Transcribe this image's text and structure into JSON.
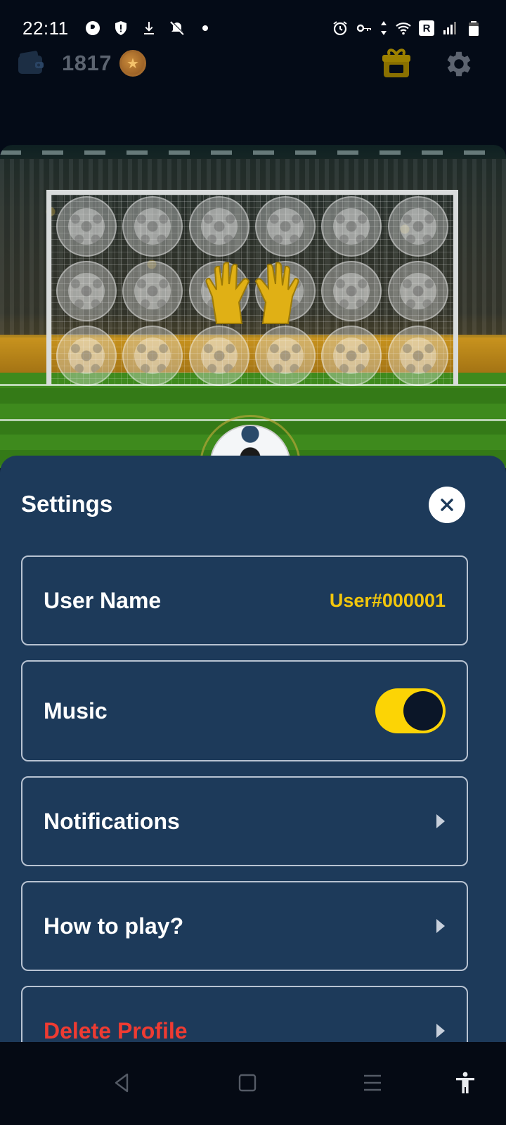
{
  "status_bar": {
    "time": "22:11",
    "left_icons": [
      "app-icon",
      "shield-icon",
      "download-icon",
      "mute-bell-icon",
      "dot-icon"
    ],
    "right_icons": [
      "alarm-icon",
      "vpn-key-icon",
      "data-arrows-icon",
      "wifi-icon",
      "roaming-badge-icon",
      "signal-icon",
      "battery-icon"
    ],
    "roaming_letter": "R"
  },
  "game_header": {
    "balance": "1817",
    "coin_symbol": "★"
  },
  "settings": {
    "title": "Settings",
    "user_name_label": "User Name",
    "user_name_value": "User#000001",
    "music_label": "Music",
    "music_on": true,
    "notifications_label": "Notifications",
    "how_to_play_label": "How to play?",
    "delete_profile_label": "Delete Profile"
  },
  "colors": {
    "sheet_bg": "#1d3a5a",
    "accent_yellow": "#f2c60c",
    "toggle_on": "#fcd405",
    "danger": "#ef3b32",
    "border": "#b8c3d2"
  },
  "nav_bar": {
    "icons": [
      "back-icon",
      "home-icon",
      "recents-icon",
      "accessibility-icon"
    ]
  }
}
